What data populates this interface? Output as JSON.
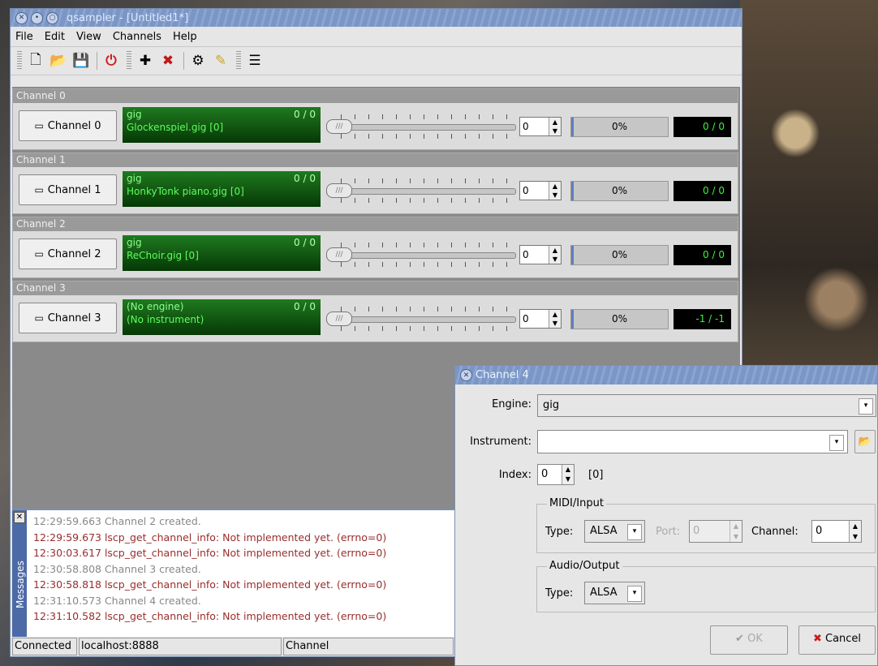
{
  "window": {
    "title": "qsampler - [Untitled1*]",
    "menu": [
      "File",
      "Edit",
      "View",
      "Channels",
      "Help"
    ],
    "toolbar_icons": [
      "new-file",
      "open-folder",
      "save",
      "power",
      "add-channel",
      "remove-channel",
      "setup-channel",
      "edit-channel",
      "view-messages"
    ]
  },
  "channels": [
    {
      "header": "Channel 0",
      "button": "Channel 0",
      "engine": "gig",
      "instrument": "Glockenspiel.gig [0]",
      "voices": "0 / 0",
      "value": "0",
      "volume": "0%",
      "meter": "0 / 0"
    },
    {
      "header": "Channel 1",
      "button": "Channel 1",
      "engine": "gig",
      "instrument": "HonkyTonk piano.gig [0]",
      "voices": "0 / 0",
      "value": "0",
      "volume": "0%",
      "meter": "0 / 0"
    },
    {
      "header": "Channel 2",
      "button": "Channel 2",
      "engine": "gig",
      "instrument": "ReChoir.gig [0]",
      "voices": "0 / 0",
      "value": "0",
      "volume": "0%",
      "meter": "0 / 0"
    },
    {
      "header": "Channel 3",
      "button": "Channel 3",
      "engine": "(No engine)",
      "instrument": "(No instrument)",
      "voices": "0 / 0",
      "value": "0",
      "volume": "0%",
      "meter": "-1 / -1"
    }
  ],
  "messages": {
    "label": "Messages",
    "lines": [
      {
        "t": "12:29:59.663 Channel 2 created.",
        "kind": "grey"
      },
      {
        "t": "12:29:59.673 lscp_get_channel_info: Not implemented yet. (errno=0)",
        "kind": "red"
      },
      {
        "t": "12:30:03.617 lscp_get_channel_info: Not implemented yet. (errno=0)",
        "kind": "red"
      },
      {
        "t": "12:30:58.808 Channel 3 created.",
        "kind": "grey"
      },
      {
        "t": "12:30:58.818 lscp_get_channel_info: Not implemented yet. (errno=0)",
        "kind": "red"
      },
      {
        "t": "12:31:10.573 Channel 4 created.",
        "kind": "grey"
      },
      {
        "t": "12:31:10.582 lscp_get_channel_info: Not implemented yet. (errno=0)",
        "kind": "red"
      }
    ]
  },
  "status": {
    "connected": "Connected",
    "host": "localhost:8888",
    "channel": "Channel"
  },
  "dialog": {
    "title": "Channel 4",
    "engine_label": "Engine:",
    "engine_value": "gig",
    "instrument_label": "Instrument:",
    "instrument_value": "",
    "index_label": "Index:",
    "index_value": "0",
    "index_suffix": "[0]",
    "midi_group": "MIDI/Input",
    "midi_type_label": "Type:",
    "midi_type_value": "ALSA",
    "port_label": "Port:",
    "port_value": "0",
    "channel_label": "Channel:",
    "channel_value": "0",
    "audio_group": "Audio/Output",
    "audio_type_label": "Type:",
    "audio_type_value": "ALSA",
    "ok_label": "OK",
    "cancel_label": "Cancel"
  }
}
